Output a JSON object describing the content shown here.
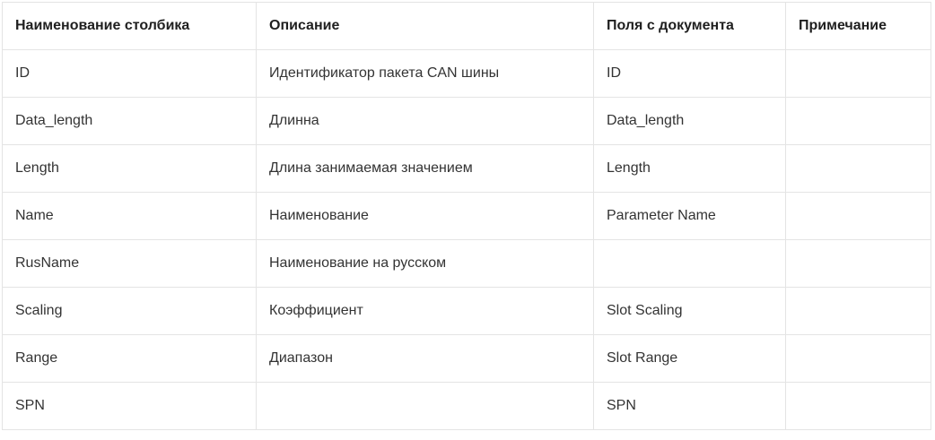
{
  "table": {
    "headers": [
      "Наименование столбика",
      "Описание",
      "Поля с документа",
      "Примечание"
    ],
    "rows": [
      [
        "ID",
        "Идентификатор пакета CAN шины",
        "ID",
        ""
      ],
      [
        "Data_length",
        "Длинна",
        "Data_length",
        ""
      ],
      [
        "Length",
        "Длина занимаемая значением",
        "Length",
        ""
      ],
      [
        "Name",
        "Наименование",
        "Parameter Name",
        ""
      ],
      [
        "RusName",
        "Наименование на русском",
        "",
        ""
      ],
      [
        "Scaling",
        "Коэффициент",
        "Slot Scaling",
        ""
      ],
      [
        "Range",
        "Диапазон",
        "Slot Range",
        ""
      ],
      [
        "SPN",
        "",
        "SPN",
        ""
      ]
    ]
  }
}
